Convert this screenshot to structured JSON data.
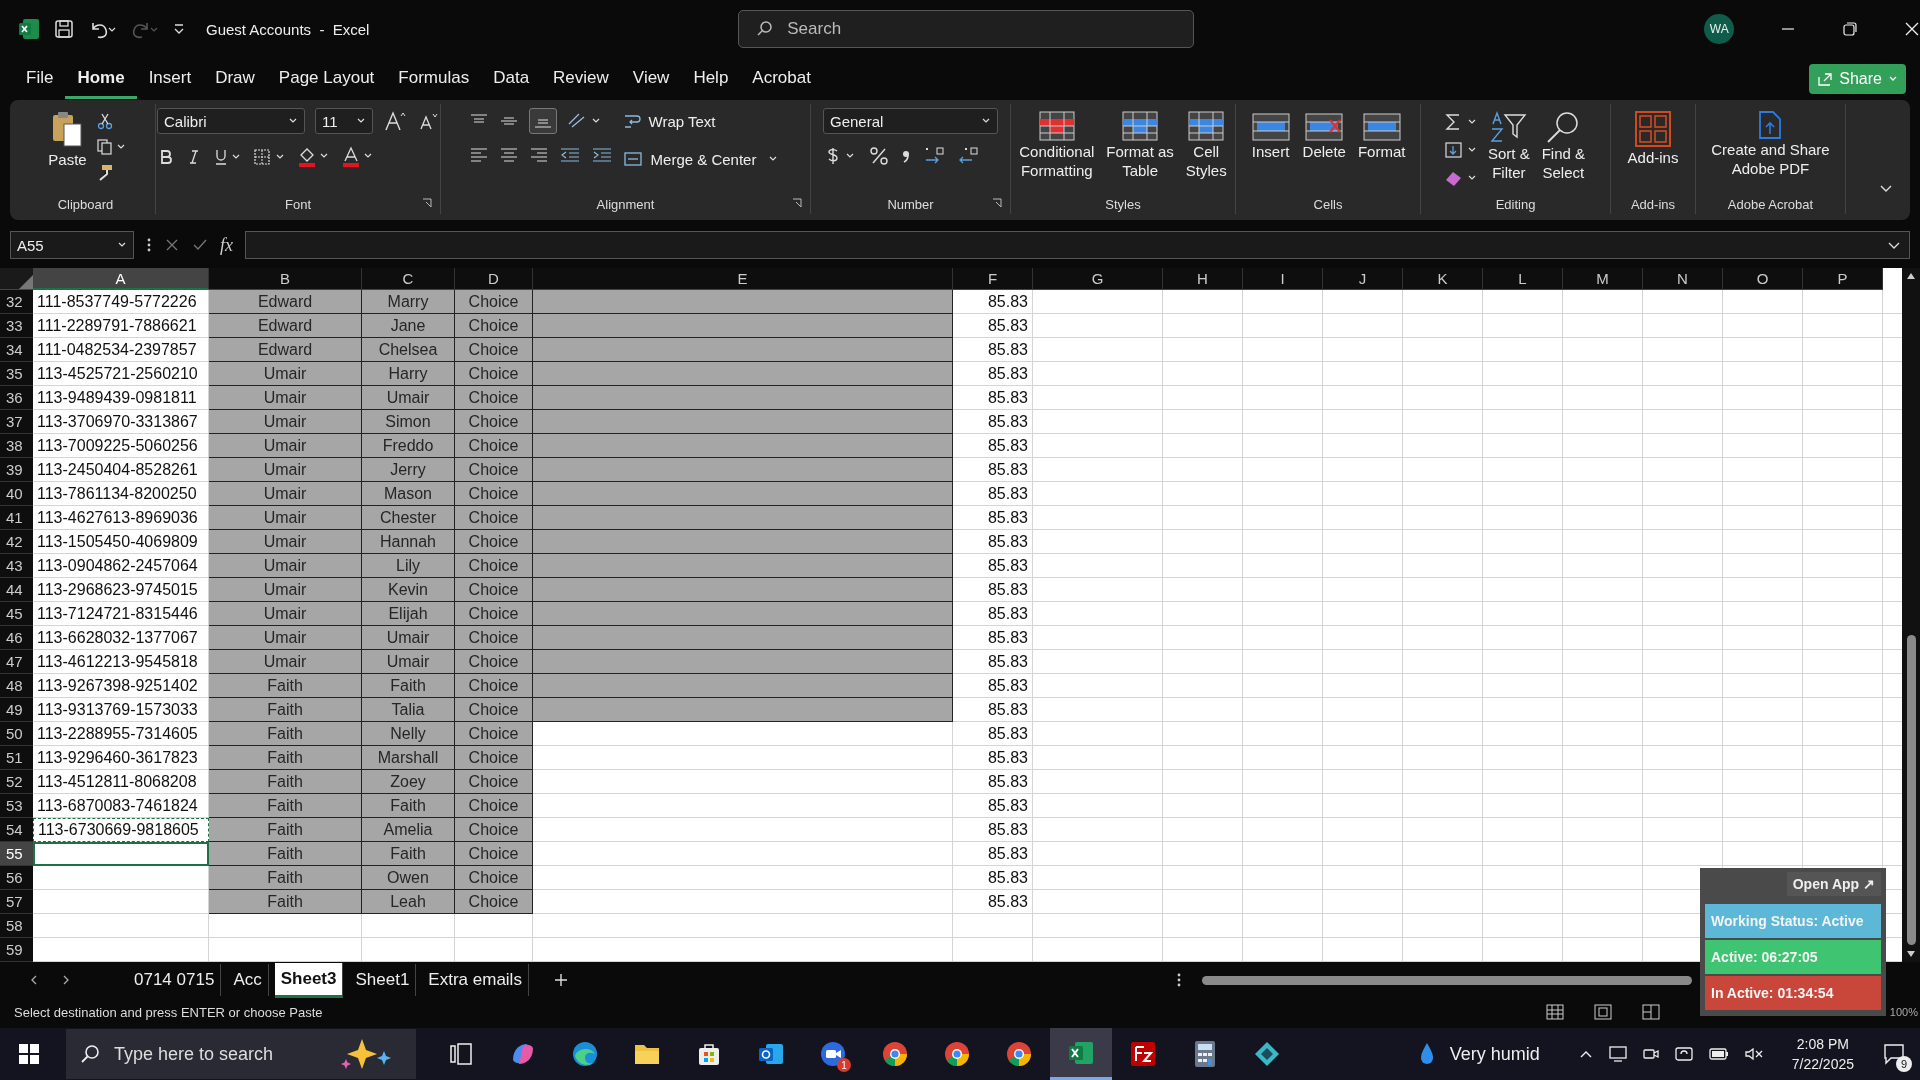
{
  "titlebar": {
    "title": "Guest Accounts  -  Excel",
    "search_placeholder": "Search",
    "avatar": "WA"
  },
  "menu": [
    {
      "label": "File",
      "selected": false
    },
    {
      "label": "Home",
      "selected": true
    },
    {
      "label": "Insert",
      "selected": false
    },
    {
      "label": "Draw",
      "selected": false
    },
    {
      "label": "Page Layout",
      "selected": false
    },
    {
      "label": "Formulas",
      "selected": false
    },
    {
      "label": "Data",
      "selected": false
    },
    {
      "label": "Review",
      "selected": false
    },
    {
      "label": "View",
      "selected": false
    },
    {
      "label": "Help",
      "selected": false
    },
    {
      "label": "Acrobat",
      "selected": false
    }
  ],
  "share": "Share",
  "ribbon": {
    "clipboard": {
      "paste": "Paste",
      "group": "Clipboard"
    },
    "font": {
      "name": "Calibri",
      "size": "11",
      "group": "Font"
    },
    "alignment": {
      "wrap": "Wrap Text",
      "merge": "Merge & Center",
      "group": "Alignment"
    },
    "number": {
      "format": "General",
      "group": "Number"
    },
    "styles": {
      "group": "Styles",
      "buttons": [
        {
          "lines": [
            "Conditional",
            "Formatting"
          ]
        },
        {
          "lines": [
            "Format as",
            "Table"
          ]
        },
        {
          "lines": [
            "Cell",
            "Styles"
          ]
        }
      ]
    },
    "cells": {
      "group": "Cells",
      "buttons": [
        "Insert",
        "Delete",
        "Format"
      ]
    },
    "editing": {
      "group": "Editing",
      "buttons": [
        {
          "lines": [
            "Sort &",
            "Filter"
          ]
        },
        {
          "lines": [
            "Find &",
            "Select"
          ]
        }
      ]
    },
    "addins": {
      "group": "Add-ins",
      "button": "Add-ins"
    },
    "acrobat": {
      "group": "Adobe Acrobat",
      "lines": [
        "Create and Share",
        "Adobe PDF"
      ]
    }
  },
  "formula_bar": {
    "name_box": "A55",
    "fx": "fx"
  },
  "columns": [
    {
      "label": "A",
      "selected": true
    },
    {
      "label": "B",
      "selected": false
    },
    {
      "label": "C",
      "selected": false
    },
    {
      "label": "D",
      "selected": false
    },
    {
      "label": "E",
      "selected": false
    },
    {
      "label": "F",
      "selected": false
    },
    {
      "label": "G",
      "selected": false
    },
    {
      "label": "H",
      "selected": false
    },
    {
      "label": "I",
      "selected": false
    },
    {
      "label": "J",
      "selected": false
    },
    {
      "label": "K",
      "selected": false
    },
    {
      "label": "L",
      "selected": false
    },
    {
      "label": "M",
      "selected": false
    },
    {
      "label": "N",
      "selected": false
    },
    {
      "label": "O",
      "selected": false
    },
    {
      "label": "P",
      "selected": false
    }
  ],
  "rows": [
    {
      "n": "32",
      "a": "111-8537749-5772226",
      "b": "Edward",
      "c": "Marry",
      "d": "Choice",
      "f": "85.83",
      "shaded_e": true,
      "copied": false,
      "selected": false
    },
    {
      "n": "33",
      "a": "111-2289791-7886621",
      "b": "Edward",
      "c": "Jane",
      "d": "Choice",
      "f": "85.83",
      "shaded_e": true,
      "copied": false,
      "selected": false
    },
    {
      "n": "34",
      "a": "111-0482534-2397857",
      "b": "Edward",
      "c": "Chelsea",
      "d": "Choice",
      "f": "85.83",
      "shaded_e": true,
      "copied": false,
      "selected": false
    },
    {
      "n": "35",
      "a": "113-4525721-2560210",
      "b": "Umair",
      "c": "Harry",
      "d": "Choice",
      "f": "85.83",
      "shaded_e": true,
      "copied": false,
      "selected": false
    },
    {
      "n": "36",
      "a": "113-9489439-0981811",
      "b": "Umair",
      "c": "Umair",
      "d": "Choice",
      "f": "85.83",
      "shaded_e": true,
      "copied": false,
      "selected": false
    },
    {
      "n": "37",
      "a": "113-3706970-3313867",
      "b": "Umair",
      "c": "Simon",
      "d": "Choice",
      "f": "85.83",
      "shaded_e": true,
      "copied": false,
      "selected": false
    },
    {
      "n": "38",
      "a": "113-7009225-5060256",
      "b": "Umair",
      "c": "Freddo",
      "d": "Choice",
      "f": "85.83",
      "shaded_e": true,
      "copied": false,
      "selected": false
    },
    {
      "n": "39",
      "a": "113-2450404-8528261",
      "b": "Umair",
      "c": "Jerry",
      "d": "Choice",
      "f": "85.83",
      "shaded_e": true,
      "copied": false,
      "selected": false
    },
    {
      "n": "40",
      "a": "113-7861134-8200250",
      "b": "Umair",
      "c": "Mason",
      "d": "Choice",
      "f": "85.83",
      "shaded_e": true,
      "copied": false,
      "selected": false
    },
    {
      "n": "41",
      "a": "113-4627613-8969036",
      "b": "Umair",
      "c": "Chester",
      "d": "Choice",
      "f": "85.83",
      "shaded_e": true,
      "copied": false,
      "selected": false
    },
    {
      "n": "42",
      "a": "113-1505450-4069809",
      "b": "Umair",
      "c": "Hannah",
      "d": "Choice",
      "f": "85.83",
      "shaded_e": true,
      "copied": false,
      "selected": false
    },
    {
      "n": "43",
      "a": "113-0904862-2457064",
      "b": "Umair",
      "c": "Lily",
      "d": "Choice",
      "f": "85.83",
      "shaded_e": true,
      "copied": false,
      "selected": false
    },
    {
      "n": "44",
      "a": "113-2968623-9745015",
      "b": "Umair",
      "c": "Kevin",
      "d": "Choice",
      "f": "85.83",
      "shaded_e": true,
      "copied": false,
      "selected": false
    },
    {
      "n": "45",
      "a": "113-7124721-8315446",
      "b": "Umair",
      "c": "Elijah",
      "d": "Choice",
      "f": "85.83",
      "shaded_e": true,
      "copied": false,
      "selected": false
    },
    {
      "n": "46",
      "a": "113-6628032-1377067",
      "b": "Umair",
      "c": "Umair",
      "d": "Choice",
      "f": "85.83",
      "shaded_e": true,
      "copied": false,
      "selected": false
    },
    {
      "n": "47",
      "a": "113-4612213-9545818",
      "b": "Umair",
      "c": "Umair",
      "d": "Choice",
      "f": "85.83",
      "shaded_e": true,
      "copied": false,
      "selected": false
    },
    {
      "n": "48",
      "a": "113-9267398-9251402",
      "b": "Faith",
      "c": "Faith",
      "d": "Choice",
      "f": "85.83",
      "shaded_e": true,
      "copied": false,
      "selected": false
    },
    {
      "n": "49",
      "a": "113-9313769-1573033",
      "b": "Faith",
      "c": "Talia",
      "d": "Choice",
      "f": "85.83",
      "shaded_e": true,
      "copied": false,
      "selected": false
    },
    {
      "n": "50",
      "a": "113-2288955-7314605",
      "b": "Faith",
      "c": "Nelly",
      "d": "Choice",
      "f": "85.83",
      "shaded_e": false,
      "copied": false,
      "selected": false
    },
    {
      "n": "51",
      "a": "113-9296460-3617823",
      "b": "Faith",
      "c": "Marshall",
      "d": "Choice",
      "f": "85.83",
      "shaded_e": false,
      "copied": false,
      "selected": false
    },
    {
      "n": "52",
      "a": "113-4512811-8068208",
      "b": "Faith",
      "c": "Zoey",
      "d": "Choice",
      "f": "85.83",
      "shaded_e": false,
      "copied": false,
      "selected": false
    },
    {
      "n": "53",
      "a": "113-6870083-7461824",
      "b": "Faith",
      "c": "Faith",
      "d": "Choice",
      "f": "85.83",
      "shaded_e": false,
      "copied": false,
      "selected": false
    },
    {
      "n": "54",
      "a": "113-6730669-9818605",
      "b": "Faith",
      "c": "Amelia",
      "d": "Choice",
      "f": "85.83",
      "shaded_e": false,
      "copied": true,
      "selected": false
    },
    {
      "n": "55",
      "b": "Faith",
      "c": "Faith",
      "d": "Choice",
      "f": "85.83",
      "shaded_e": false,
      "copied": false,
      "selected": true
    },
    {
      "n": "56",
      "b": "Faith",
      "c": "Owen",
      "d": "Choice",
      "f": "85.83",
      "shaded_e": false,
      "copied": false,
      "selected": false
    },
    {
      "n": "57",
      "b": "Faith",
      "c": "Leah",
      "d": "Choice",
      "f": "85.83",
      "shaded_e": false,
      "copied": false,
      "selected": false
    },
    {
      "n": "58",
      "shaded_e": false,
      "copied": false,
      "selected": false
    },
    {
      "n": "59",
      "shaded_e": false,
      "copied": false,
      "selected": false
    }
  ],
  "sheet_tabs": [
    {
      "label": "0714 0715",
      "selected": false
    },
    {
      "label": "Acc",
      "selected": false
    },
    {
      "label": "Sheet3",
      "selected": true
    },
    {
      "label": "Sheet1",
      "selected": false
    },
    {
      "label": "Extra emails",
      "selected": false
    }
  ],
  "status": "Select destination and press ENTER or choose Paste",
  "zoom": "100%",
  "tracker": {
    "open": "Open App ↗",
    "items": [
      {
        "label": "Working Status: Active",
        "color": "#5cb8d6"
      },
      {
        "label": "Active: 06:27:05",
        "color": "#3fc472"
      },
      {
        "label": "In Active: 01:34:54",
        "color": "#c9463a"
      }
    ]
  },
  "taskbar": {
    "search_placeholder": "Type here to search",
    "badge": "1",
    "weather": "Very humid",
    "time": "2:08 PM",
    "date": "7/22/2025",
    "notifications": "9"
  }
}
